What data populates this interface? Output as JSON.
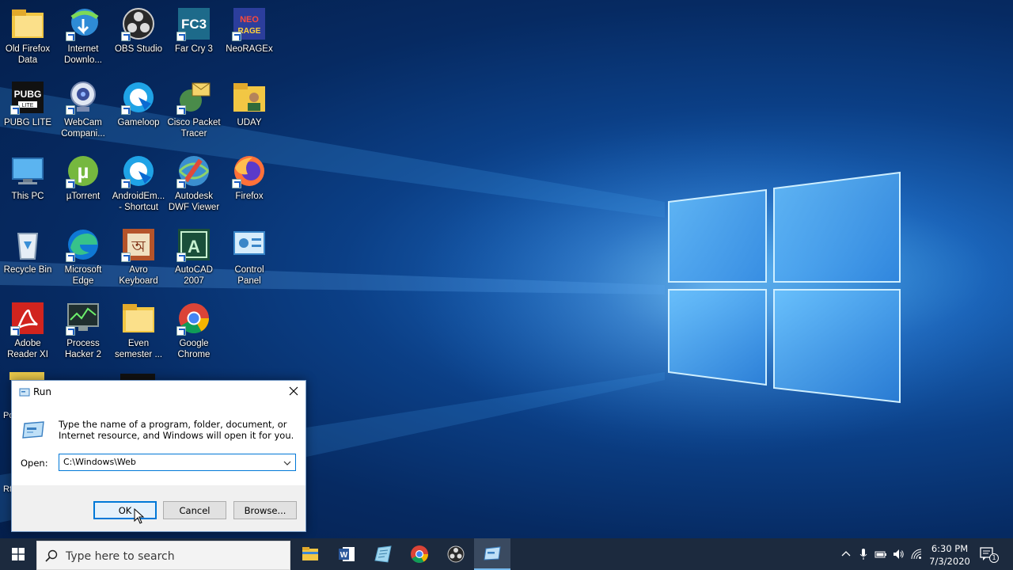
{
  "desktop": {
    "icons": [
      {
        "label": "Old Firefox\nData",
        "icon": "folder-icon"
      },
      {
        "label": "Internet\nDownlo...",
        "icon": "idm-icon"
      },
      {
        "label": "OBS Studio",
        "icon": "obs-icon"
      },
      {
        "label": "Far Cry 3",
        "icon": "farcry-icon"
      },
      {
        "label": "NeoRAGEx",
        "icon": "neorage-icon"
      },
      {
        "label": "PUBG LITE",
        "icon": "pubg-icon"
      },
      {
        "label": "WebCam\nCompani...",
        "icon": "webcam-icon"
      },
      {
        "label": "Gameloop",
        "icon": "gameloop-icon"
      },
      {
        "label": "Cisco Packet\nTracer",
        "icon": "cisco-icon"
      },
      {
        "label": "UDAY",
        "icon": "user-folder-icon"
      },
      {
        "label": "This PC",
        "icon": "computer-icon"
      },
      {
        "label": "µTorrent",
        "icon": "utorrent-icon"
      },
      {
        "label": "AndroidEm...\n- Shortcut",
        "icon": "android-emulator-icon"
      },
      {
        "label": "Autodesk\nDWF Viewer",
        "icon": "dwf-viewer-icon"
      },
      {
        "label": "Firefox",
        "icon": "firefox-icon"
      },
      {
        "label": "Recycle Bin",
        "icon": "recycle-bin-icon"
      },
      {
        "label": "Microsoft\nEdge",
        "icon": "edge-icon"
      },
      {
        "label": "Avro\nKeyboard",
        "icon": "avro-icon"
      },
      {
        "label": "AutoCAD\n2007",
        "icon": "autocad-icon"
      },
      {
        "label": "Control\nPanel",
        "icon": "control-panel-icon"
      },
      {
        "label": "Adobe\nReader XI",
        "icon": "adobe-reader-icon"
      },
      {
        "label": "Process\nHacker 2",
        "icon": "process-hacker-icon"
      },
      {
        "label": "Even\nsemester ...",
        "icon": "folder-icon"
      },
      {
        "label": "Google\nChrome",
        "icon": "chrome-icon"
      }
    ],
    "peek_labels": [
      "Po",
      "Rt"
    ]
  },
  "run_dialog": {
    "title": "Run",
    "description": "Type the name of a program, folder, document, or Internet resource, and Windows will open it for you.",
    "open_label": "Open:",
    "open_value": "C:\\Windows\\Web",
    "ok_label": "OK",
    "cancel_label": "Cancel",
    "browse_label": "Browse..."
  },
  "taskbar": {
    "search_placeholder": "Type here to search",
    "apps": [
      "file-explorer-icon",
      "word-icon",
      "notepad-icon",
      "chrome-icon",
      "obs-icon",
      "run-icon"
    ],
    "time": "6:30 PM",
    "date": "7/3/2020",
    "notification_count": "1"
  },
  "colors": {
    "taskbar": "#1c2a3e",
    "accent": "#0078d7"
  }
}
